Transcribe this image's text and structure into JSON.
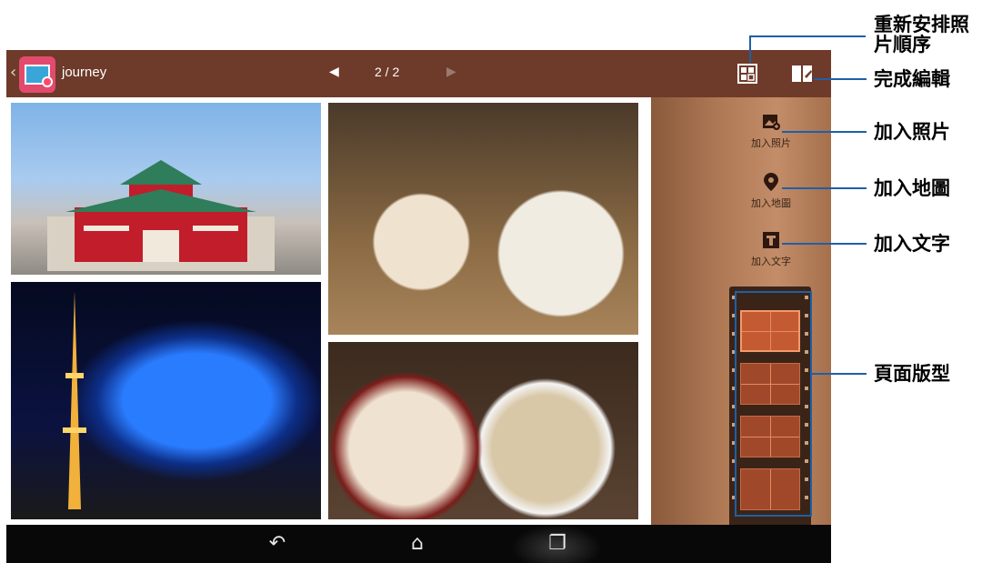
{
  "app": {
    "title": "journey",
    "pager": "2 / 2"
  },
  "tools": {
    "add_photo": "加入照片",
    "add_map": "加入地圖",
    "add_text": "加入文字"
  },
  "callouts": {
    "reorder_line1": "重新安排照",
    "reorder_line2": "片順序",
    "done": "完成編輯",
    "add_photo": "加入照片",
    "add_map": "加入地圖",
    "add_text": "加入文字",
    "layout": "頁面版型"
  },
  "icons": {
    "back": "chevron-left-icon",
    "prev": "triangle-left-icon",
    "next": "triangle-right-icon",
    "reorder": "grid-reorder-icon",
    "done": "book-done-icon",
    "nav_back": "back-arrow-icon",
    "nav_home": "home-icon",
    "nav_recent": "recent-apps-icon"
  },
  "colors": {
    "topbar": "#6e3a2a",
    "callout_line": "#1f5fa8",
    "panel_wood": "#b07a56"
  }
}
